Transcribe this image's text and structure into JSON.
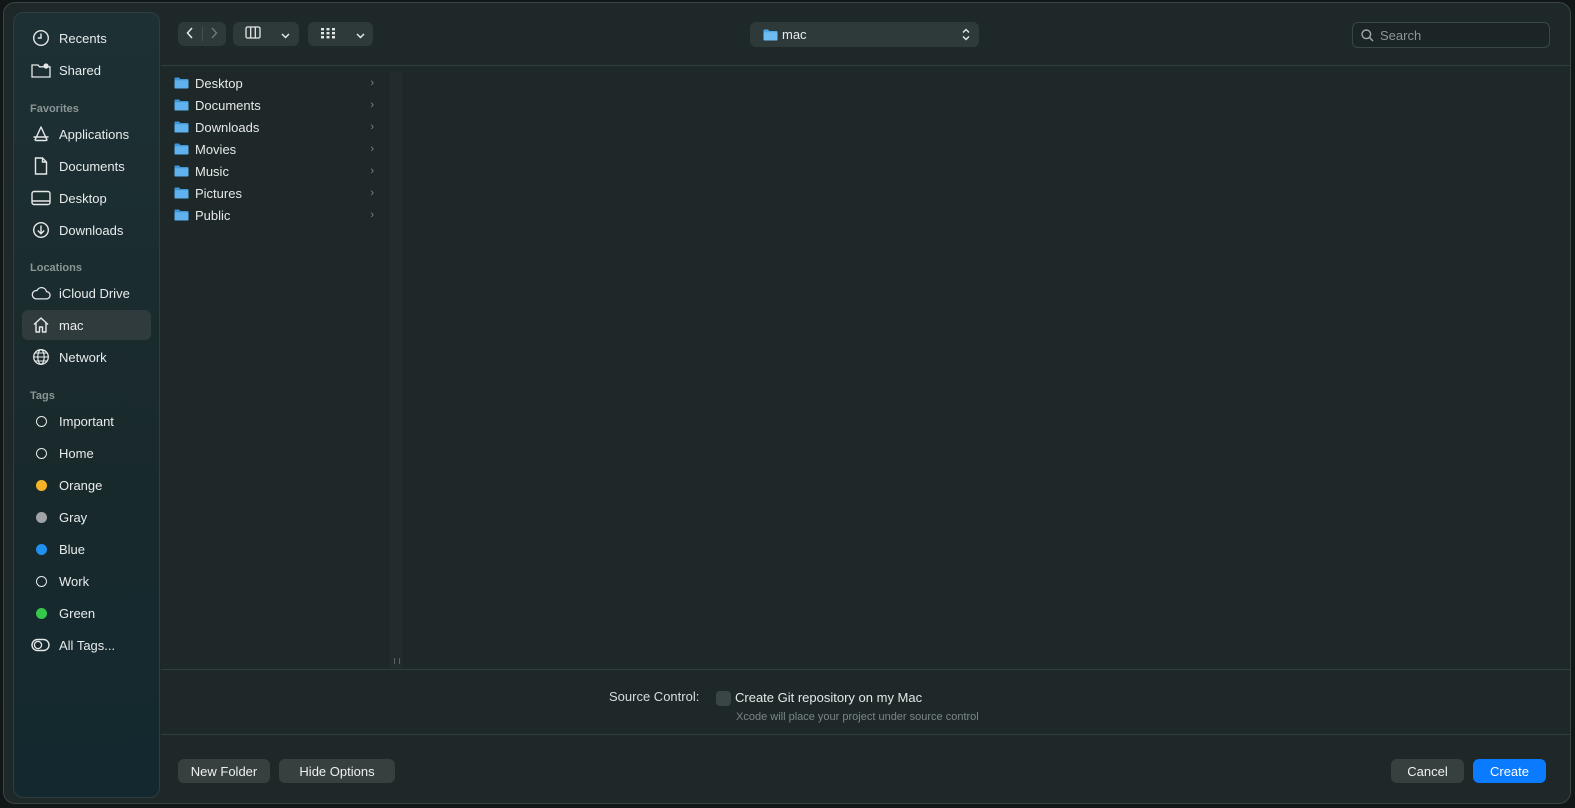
{
  "sidebar": {
    "items_top": [
      {
        "label": "Recents",
        "icon": "clock-icon"
      },
      {
        "label": "Shared",
        "icon": "shared-folder-icon"
      }
    ],
    "favorites_title": "Favorites",
    "favorites": [
      {
        "label": "Applications",
        "icon": "applications-icon"
      },
      {
        "label": "Documents",
        "icon": "document-icon"
      },
      {
        "label": "Desktop",
        "icon": "desktop-icon"
      },
      {
        "label": "Downloads",
        "icon": "download-icon"
      }
    ],
    "locations_title": "Locations",
    "locations": [
      {
        "label": "iCloud Drive",
        "icon": "cloud-icon"
      },
      {
        "label": "mac",
        "icon": "home-icon",
        "selected": true
      },
      {
        "label": "Network",
        "icon": "globe-icon"
      }
    ],
    "tags_title": "Tags",
    "tags": [
      {
        "label": "Important",
        "color": ""
      },
      {
        "label": "Home",
        "color": ""
      },
      {
        "label": "Orange",
        "color": "#f5b428"
      },
      {
        "label": "Gray",
        "color": "#a0a4a6"
      },
      {
        "label": "Blue",
        "color": "#1f8ff0"
      },
      {
        "label": "Work",
        "color": ""
      },
      {
        "label": "Green",
        "color": "#35c84a"
      },
      {
        "label": "All Tags...",
        "color": "",
        "icon": "all-tags-icon"
      }
    ]
  },
  "toolbar": {
    "path_label": "mac",
    "search_placeholder": "Search"
  },
  "folders": [
    "Desktop",
    "Documents",
    "Downloads",
    "Movies",
    "Music",
    "Pictures",
    "Public"
  ],
  "options": {
    "source_control_label": "Source Control:",
    "git_checkbox_label": "Create Git repository on my Mac",
    "git_checkbox_checked": false,
    "hint": "Xcode will place your project under source control"
  },
  "buttons": {
    "new_folder": "New Folder",
    "hide_options": "Hide Options",
    "cancel": "Cancel",
    "create": "Create"
  },
  "colors": {
    "accent": "#0a7aff",
    "folder": "#4ea8e8"
  }
}
